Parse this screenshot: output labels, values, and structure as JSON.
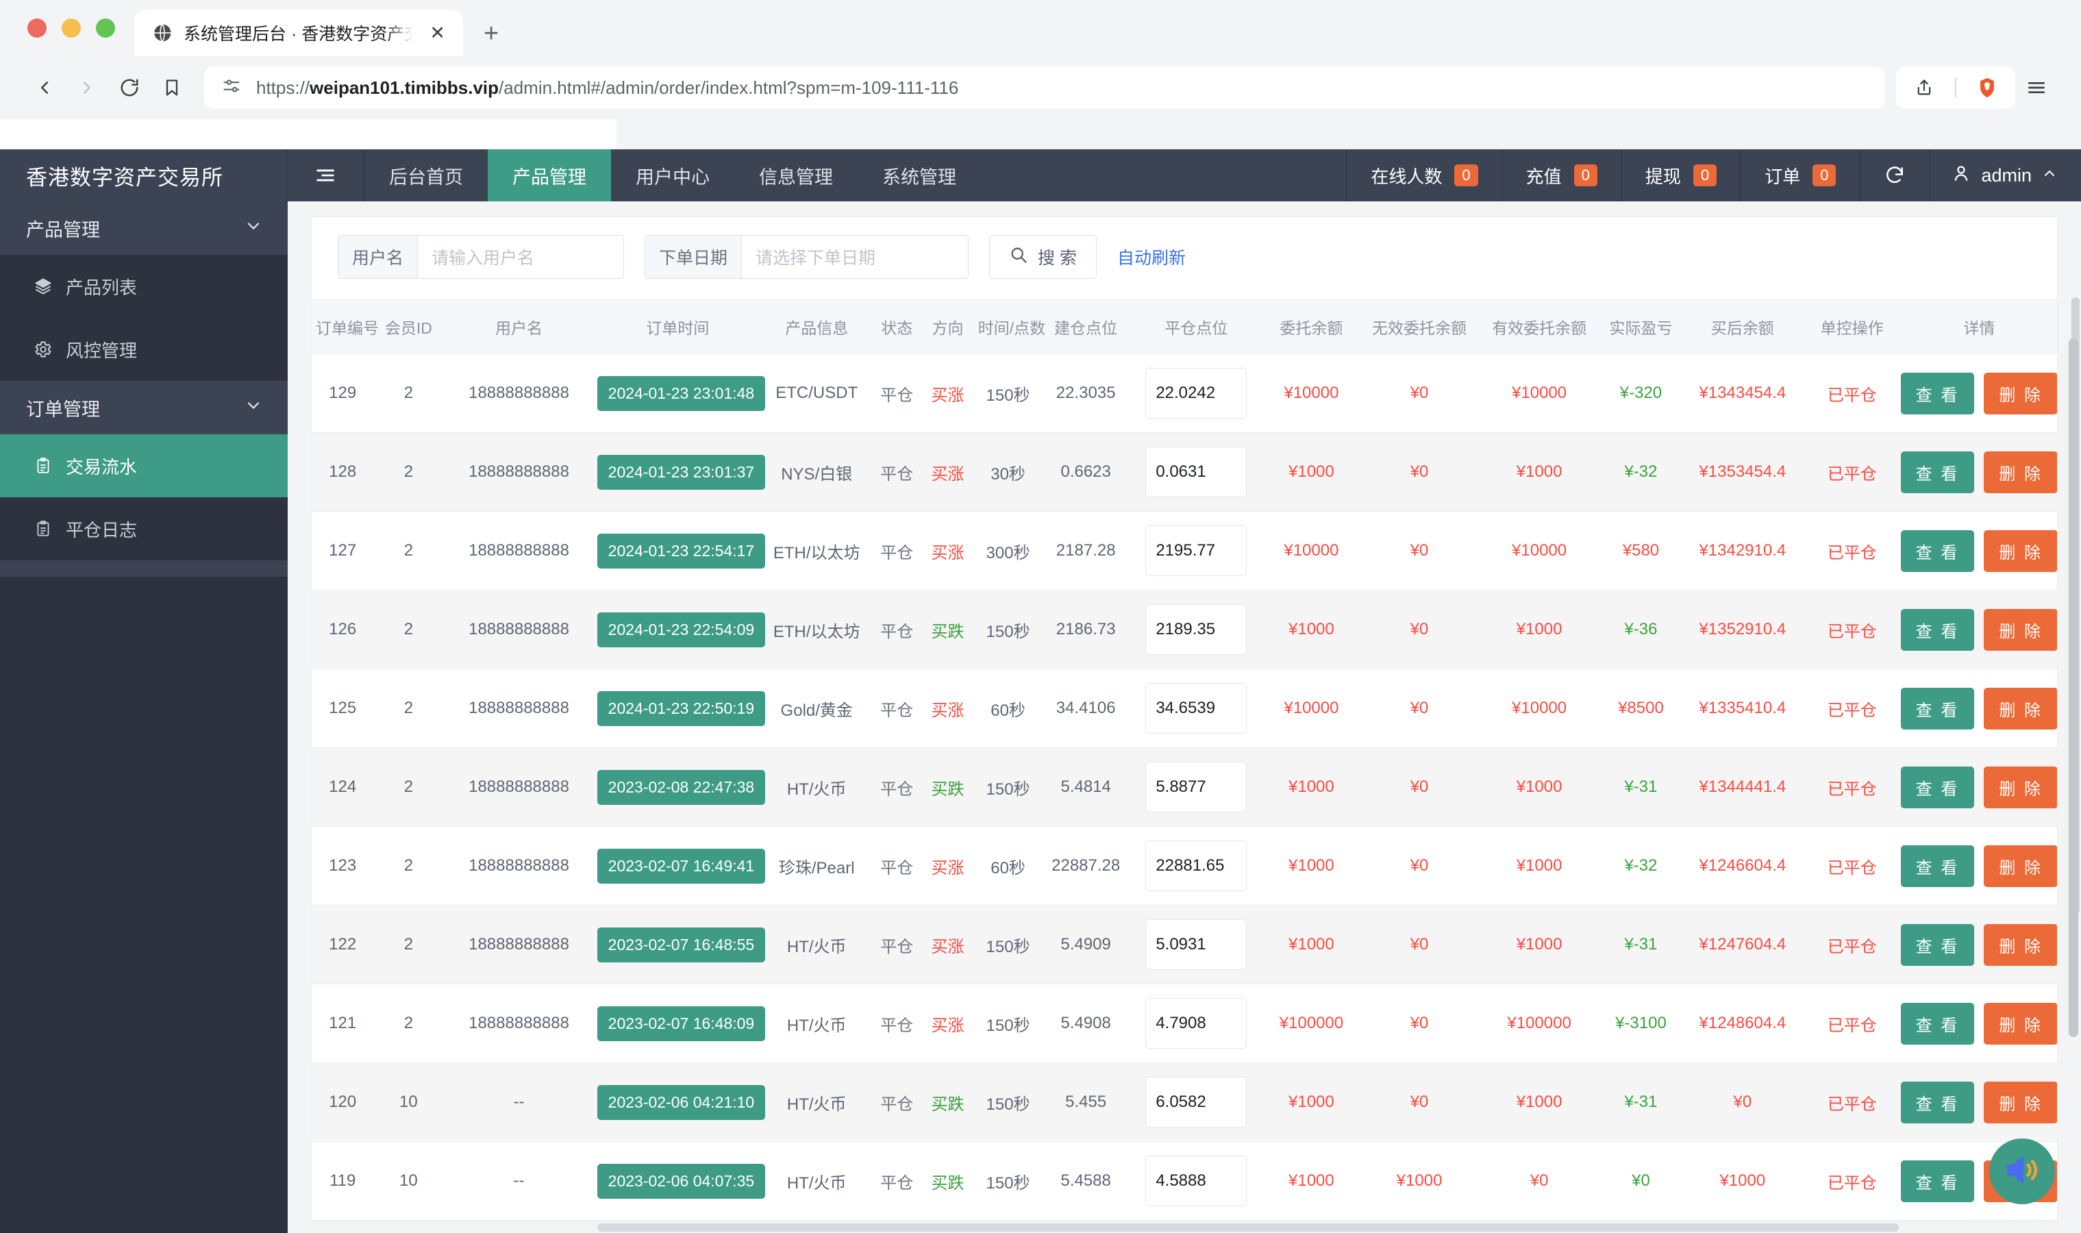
{
  "browser": {
    "tab_title": "系统管理后台 · 香港数字资产交易所",
    "tab_close_label": "✕",
    "new_tab_label": "+",
    "url_prefix": "https://",
    "url_host": "weipan101.timibbs.vip",
    "url_path": "/admin.html#/admin/order/index.html?spm=m-109-111-116",
    "url_full": "https://weipan101.timibbs.vip/admin.html#/admin/order/index.html?spm=m-109-111-116"
  },
  "header": {
    "brand": "香港数字资产交易所",
    "collapse_icon": "menu-collapse-icon",
    "nav": [
      {
        "label": "后台首页",
        "active": false
      },
      {
        "label": "产品管理",
        "active": true
      },
      {
        "label": "用户中心",
        "active": false
      },
      {
        "label": "信息管理",
        "active": false
      },
      {
        "label": "系统管理",
        "active": false
      }
    ],
    "stats": [
      {
        "label": "在线人数",
        "value": "0"
      },
      {
        "label": "充值",
        "value": "0"
      },
      {
        "label": "提现",
        "value": "0"
      },
      {
        "label": "订单",
        "value": "0"
      }
    ],
    "refresh_icon": "refresh-icon",
    "user_name": "admin",
    "user_caret": "chevron-up-icon"
  },
  "sidebar": {
    "groups": [
      {
        "label": "产品管理",
        "items": [
          {
            "label": "产品列表",
            "icon": "layers-icon",
            "active": false
          },
          {
            "label": "风控管理",
            "icon": "gear-icon",
            "active": false
          }
        ]
      },
      {
        "label": "订单管理",
        "items": [
          {
            "label": "交易流水",
            "icon": "clipboard-icon",
            "active": true
          },
          {
            "label": "平仓日志",
            "icon": "clipboard-icon",
            "active": false
          }
        ]
      }
    ]
  },
  "filters": {
    "username_label": "用户名",
    "username_placeholder": "请输入用户名",
    "username_value": "",
    "date_label": "下单日期",
    "date_placeholder": "请选择下单日期",
    "date_value": "",
    "search_button": "搜 索",
    "search_icon": "search-icon",
    "auto_refresh": "自动刷新"
  },
  "table": {
    "columns": [
      "订单编号",
      "会员ID",
      "用户名",
      "订单时间",
      "产品信息",
      "状态",
      "方向",
      "时间/点数",
      "建仓点位",
      "平仓点位",
      "委托余额",
      "无效委托余额",
      "有效委托余额",
      "实际盈亏",
      "买后余额",
      "单控操作",
      "详情"
    ],
    "view_button": "查 看",
    "delete_button": "删 除",
    "rows": [
      {
        "order_no": "129",
        "member_id": "2",
        "username": "18888888888",
        "order_time": "2024-01-23 23:01:48",
        "product": "ETC/USDT",
        "status": "平仓",
        "direction": "买涨",
        "direction_type": "up",
        "duration": "150秒",
        "open_price": "22.3035",
        "close_price": "22.0242",
        "entrust_balance": "¥10000",
        "invalid_entrust": "¥0",
        "valid_entrust": "¥10000",
        "pnl": "¥-320",
        "pnl_type": "green",
        "balance_after": "¥1343454.4",
        "control": "已平仓"
      },
      {
        "order_no": "128",
        "member_id": "2",
        "username": "18888888888",
        "order_time": "2024-01-23 23:01:37",
        "product": "NYS/白银",
        "status": "平仓",
        "direction": "买涨",
        "direction_type": "up",
        "duration": "30秒",
        "open_price": "0.6623",
        "close_price": "0.0631",
        "entrust_balance": "¥1000",
        "invalid_entrust": "¥0",
        "valid_entrust": "¥1000",
        "pnl": "¥-32",
        "pnl_type": "green",
        "balance_after": "¥1353454.4",
        "control": "已平仓"
      },
      {
        "order_no": "127",
        "member_id": "2",
        "username": "18888888888",
        "order_time": "2024-01-23 22:54:17",
        "product": "ETH/以太坊",
        "status": "平仓",
        "direction": "买涨",
        "direction_type": "up",
        "duration": "300秒",
        "open_price": "2187.28",
        "close_price": "2195.77",
        "entrust_balance": "¥10000",
        "invalid_entrust": "¥0",
        "valid_entrust": "¥10000",
        "pnl": "¥580",
        "pnl_type": "red",
        "balance_after": "¥1342910.4",
        "control": "已平仓"
      },
      {
        "order_no": "126",
        "member_id": "2",
        "username": "18888888888",
        "order_time": "2024-01-23 22:54:09",
        "product": "ETH/以太坊",
        "status": "平仓",
        "direction": "买跌",
        "direction_type": "down",
        "duration": "150秒",
        "open_price": "2186.73",
        "close_price": "2189.35",
        "entrust_balance": "¥1000",
        "invalid_entrust": "¥0",
        "valid_entrust": "¥1000",
        "pnl": "¥-36",
        "pnl_type": "green",
        "balance_after": "¥1352910.4",
        "control": "已平仓"
      },
      {
        "order_no": "125",
        "member_id": "2",
        "username": "18888888888",
        "order_time": "2024-01-23 22:50:19",
        "product": "Gold/黄金",
        "status": "平仓",
        "direction": "买涨",
        "direction_type": "up",
        "duration": "60秒",
        "open_price": "34.4106",
        "close_price": "34.6539",
        "entrust_balance": "¥10000",
        "invalid_entrust": "¥0",
        "valid_entrust": "¥10000",
        "pnl": "¥8500",
        "pnl_type": "red",
        "balance_after": "¥1335410.4",
        "control": "已平仓"
      },
      {
        "order_no": "124",
        "member_id": "2",
        "username": "18888888888",
        "order_time": "2023-02-08 22:47:38",
        "product": "HT/火币",
        "status": "平仓",
        "direction": "买跌",
        "direction_type": "down",
        "duration": "150秒",
        "open_price": "5.4814",
        "close_price": "5.8877",
        "entrust_balance": "¥1000",
        "invalid_entrust": "¥0",
        "valid_entrust": "¥1000",
        "pnl": "¥-31",
        "pnl_type": "green",
        "balance_after": "¥1344441.4",
        "control": "已平仓"
      },
      {
        "order_no": "123",
        "member_id": "2",
        "username": "18888888888",
        "order_time": "2023-02-07 16:49:41",
        "product": "珍珠/Pearl",
        "status": "平仓",
        "direction": "买涨",
        "direction_type": "up",
        "duration": "60秒",
        "open_price": "22887.28",
        "close_price": "22881.65",
        "entrust_balance": "¥1000",
        "invalid_entrust": "¥0",
        "valid_entrust": "¥1000",
        "pnl": "¥-32",
        "pnl_type": "green",
        "balance_after": "¥1246604.4",
        "control": "已平仓"
      },
      {
        "order_no": "122",
        "member_id": "2",
        "username": "18888888888",
        "order_time": "2023-02-07 16:48:55",
        "product": "HT/火币",
        "status": "平仓",
        "direction": "买涨",
        "direction_type": "up",
        "duration": "150秒",
        "open_price": "5.4909",
        "close_price": "5.0931",
        "entrust_balance": "¥1000",
        "invalid_entrust": "¥0",
        "valid_entrust": "¥1000",
        "pnl": "¥-31",
        "pnl_type": "green",
        "balance_after": "¥1247604.4",
        "control": "已平仓"
      },
      {
        "order_no": "121",
        "member_id": "2",
        "username": "18888888888",
        "order_time": "2023-02-07 16:48:09",
        "product": "HT/火币",
        "status": "平仓",
        "direction": "买涨",
        "direction_type": "up",
        "duration": "150秒",
        "open_price": "5.4908",
        "close_price": "4.7908",
        "entrust_balance": "¥100000",
        "invalid_entrust": "¥0",
        "valid_entrust": "¥100000",
        "pnl": "¥-3100",
        "pnl_type": "green",
        "balance_after": "¥1248604.4",
        "control": "已平仓"
      },
      {
        "order_no": "120",
        "member_id": "10",
        "username": "--",
        "order_time": "2023-02-06 04:21:10",
        "product": "HT/火币",
        "status": "平仓",
        "direction": "买跌",
        "direction_type": "down",
        "duration": "150秒",
        "open_price": "5.455",
        "close_price": "6.0582",
        "entrust_balance": "¥1000",
        "invalid_entrust": "¥0",
        "valid_entrust": "¥1000",
        "pnl": "¥-31",
        "pnl_type": "green",
        "balance_after": "¥0",
        "control": "已平仓"
      },
      {
        "order_no": "119",
        "member_id": "10",
        "username": "--",
        "order_time": "2023-02-06 04:07:35",
        "product": "HT/火币",
        "status": "平仓",
        "direction": "买跌",
        "direction_type": "down",
        "duration": "150秒",
        "open_price": "5.4588",
        "close_price": "4.5888",
        "entrust_balance": "¥1000",
        "invalid_entrust": "¥1000",
        "valid_entrust": "¥0",
        "pnl": "¥0",
        "pnl_type": "green",
        "balance_after": "¥1000",
        "control": "已平仓"
      }
    ]
  },
  "floating": {
    "sound_icon": "sound-speaker-icon"
  },
  "colors": {
    "header_bg": "#3c4353",
    "sidebar_bg": "#2d323e",
    "accent_teal": "#3d9b86",
    "accent_orange": "#ec6a38",
    "up_red": "#fb4c42",
    "down_green": "#3aa33e",
    "link_blue": "#3a72e8"
  }
}
